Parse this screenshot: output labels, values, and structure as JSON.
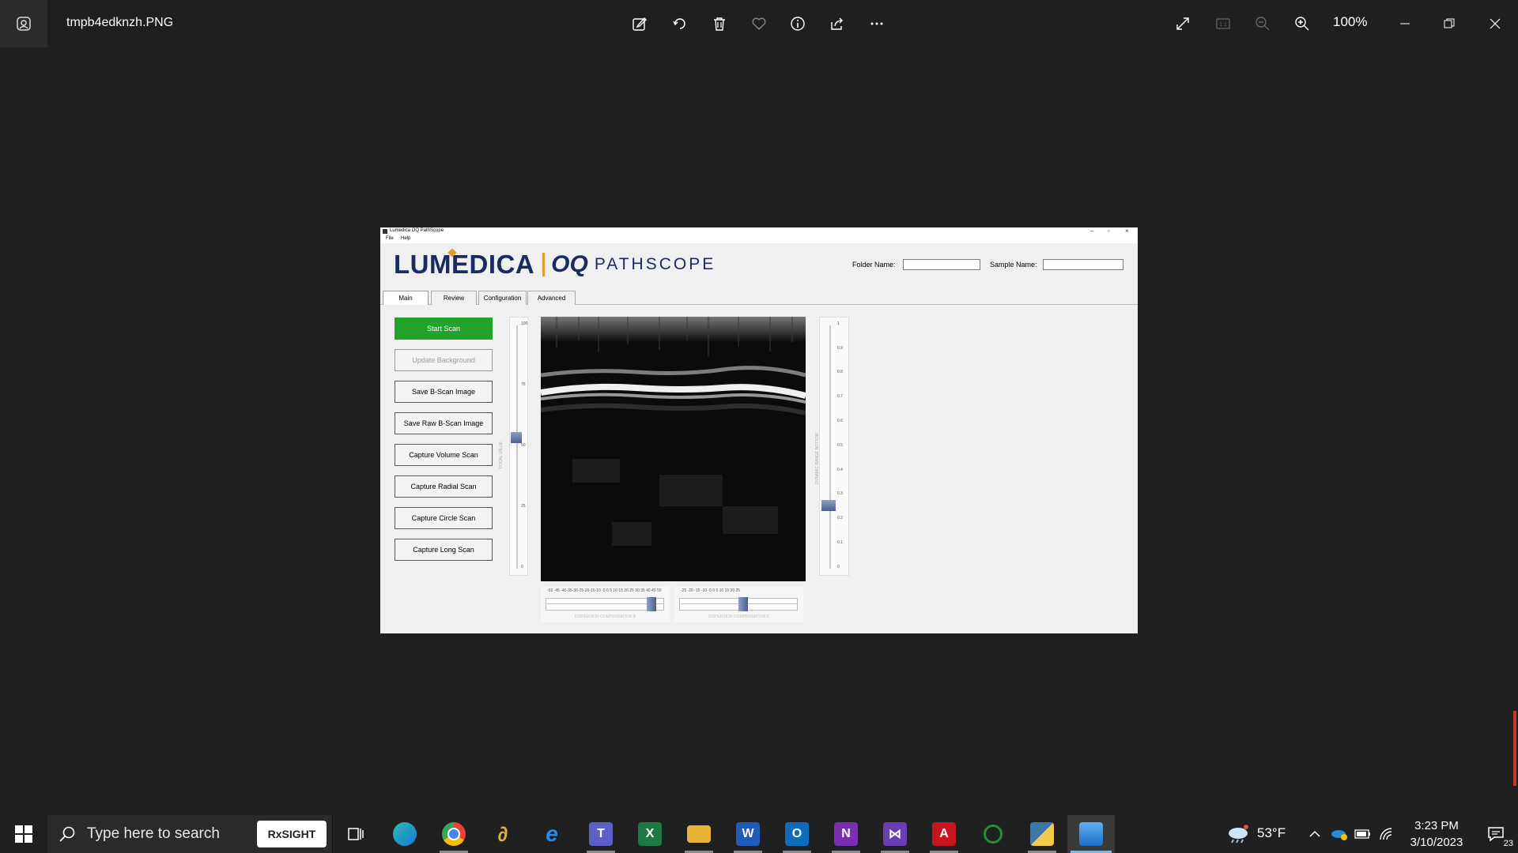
{
  "viewer": {
    "file_name": "tmpb4edknzh.PNG",
    "zoom": "100%",
    "toolbar_icons": [
      "edit-icon",
      "rotate-icon",
      "delete-icon",
      "favorite-icon",
      "info-icon",
      "share-icon",
      "more-icon"
    ],
    "right_icons": [
      "fullscreen-icon",
      "actual-size-icon",
      "zoom-out-icon",
      "zoom-in-icon"
    ]
  },
  "app": {
    "window_title": "Lumedica OQ PathScope",
    "menu": [
      "File",
      "Help"
    ],
    "logo": {
      "brand": "LUMEDICA",
      "product_oq": "OQ",
      "product_name": "PATHSCOPE"
    },
    "folder_label": "Folder Name:",
    "folder_value": "",
    "sample_label": "Sample Name:",
    "sample_value": "",
    "tabs": [
      "Main",
      "Review",
      "Configuration",
      "Advanced"
    ],
    "active_tab": "Main",
    "buttons": [
      "Start Scan",
      "Update Background",
      "Save B-Scan Image",
      "Save Raw B-Scan Image",
      "Capture Volume Scan",
      "Capture Radial Scan",
      "Capture Circle Scan",
      "Capture Long Scan"
    ],
    "left_slider": {
      "ticks": [
        "100",
        "75",
        "50",
        "25",
        "0"
      ],
      "label": "FOCAL VALUE",
      "value": 54
    },
    "right_slider": {
      "ticks": [
        "1",
        "0.9",
        "0.8",
        "0.7",
        "0.6",
        "0.5",
        "0.4",
        "0.3",
        "0.2",
        "0.1",
        "0"
      ],
      "label": "DYNAMIC RANGE BOTTOM",
      "value": 0.26
    },
    "dispersion_b": {
      "ticks": "-50 -45 -40-35-30-25-20-15-10 -5  0   5  10 15 20 25 30 35 40 45  50",
      "label": "DISPERSION COMPENSATION B",
      "value": 40
    },
    "dispersion_c": {
      "ticks": "-25  -20  -15  -10   -5    0    5   10   15   20   25",
      "label": "DISPERSION COMPENSATION C",
      "value": 2
    },
    "accent_green": "#22a32a",
    "brand_navy": "#1b2a63",
    "brand_orange": "#e49a2d"
  },
  "taskbar": {
    "search_placeholder": "Type here to search",
    "search_badge": "RxSIGHT",
    "apps": [
      "task-view-icon",
      "edge-icon",
      "chrome-icon",
      "app-icon",
      "internet-explorer-icon",
      "teams-icon",
      "excel-icon",
      "file-explorer-icon",
      "word-icon",
      "outlook-icon",
      "onenote-icon",
      "visual-studio-icon",
      "acrobat-icon",
      "circle-app-icon",
      "python-icon",
      "photos-icon"
    ],
    "weather": "53°F",
    "time": "3:23 PM",
    "date": "3/10/2023",
    "notification_count": "23"
  }
}
